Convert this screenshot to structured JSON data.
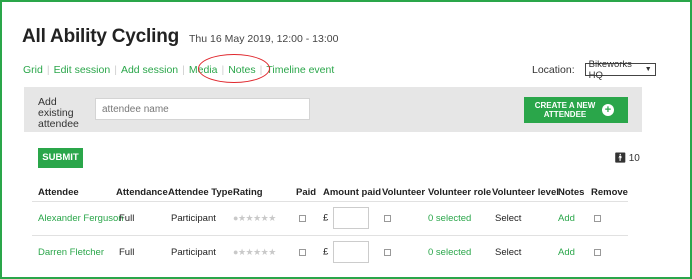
{
  "header": {
    "title": "All Ability Cycling",
    "subtitle": "Thu 16 May 2019, 12:00 - 13:00"
  },
  "nav": {
    "items": [
      "Grid",
      "Edit session",
      "Add session",
      "Media",
      "Notes",
      "Timeline event"
    ]
  },
  "location": {
    "label": "Location:",
    "value": "Bikeworks HQ",
    "arrow": "▼"
  },
  "add_bar": {
    "label": "Add existing attendee",
    "placeholder": "attendee name",
    "create_button": "CREATE A NEW ATTENDEE"
  },
  "submit_label": "SUBMIT",
  "attendee_count": "10",
  "table": {
    "headers": [
      "Attendee",
      "Attendance",
      "Attendee Type",
      "Rating",
      "Paid",
      "Amount paid",
      "Volunteer",
      "Volunteer role",
      "Volunteer level",
      "Notes",
      "Remove"
    ],
    "currency": "£",
    "rows": [
      {
        "attendee": "Alexander Ferguson",
        "attendance": "Full",
        "type": "Participant",
        "volunteer_role": "0 selected",
        "volunteer_level": "Select",
        "notes": "Add"
      },
      {
        "attendee": "Darren Fletcher",
        "attendance": "Full",
        "type": "Participant",
        "volunteer_role": "0 selected",
        "volunteer_level": "Select",
        "notes": "Add"
      }
    ]
  },
  "colors": {
    "accent": "#2aa64a",
    "highlight_ring": "#e0282e",
    "add_bar_bg": "#e6e6e6"
  }
}
